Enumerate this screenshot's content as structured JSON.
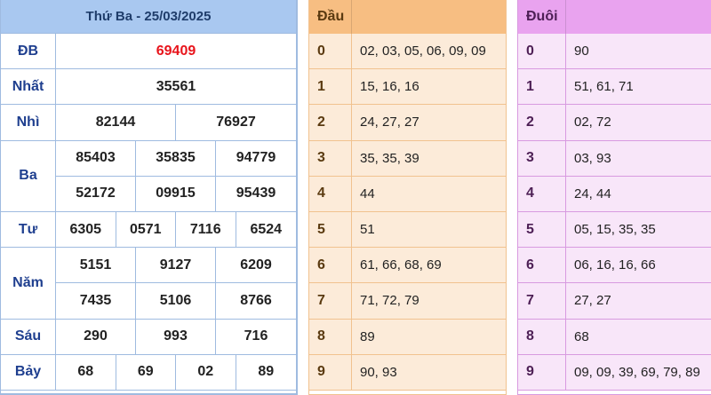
{
  "results": {
    "title": "Thứ Ba - 25/03/2025",
    "prizes": [
      {
        "label": "ĐB",
        "rows": [
          [
            "69409"
          ]
        ]
      },
      {
        "label": "Nhất",
        "rows": [
          [
            "35561"
          ]
        ]
      },
      {
        "label": "Nhì",
        "rows": [
          [
            "82144",
            "76927"
          ]
        ]
      },
      {
        "label": "Ba",
        "rows": [
          [
            "85403",
            "35835",
            "94779"
          ],
          [
            "52172",
            "09915",
            "95439"
          ]
        ]
      },
      {
        "label": "Tư",
        "rows": [
          [
            "6305",
            "0571",
            "7116",
            "6524"
          ]
        ]
      },
      {
        "label": "Năm",
        "rows": [
          [
            "5151",
            "9127",
            "6209"
          ],
          [
            "7435",
            "5106",
            "8766"
          ]
        ]
      },
      {
        "label": "Sáu",
        "rows": [
          [
            "290",
            "993",
            "716"
          ]
        ]
      },
      {
        "label": "Bảy",
        "rows": [
          [
            "68",
            "69",
            "02",
            "89"
          ]
        ]
      }
    ]
  },
  "dau": {
    "header": "Đầu",
    "rows": [
      {
        "digit": "0",
        "values": "02, 03, 05, 06, 09, 09"
      },
      {
        "digit": "1",
        "values": "15, 16, 16"
      },
      {
        "digit": "2",
        "values": "24, 27, 27"
      },
      {
        "digit": "3",
        "values": "35, 35, 39"
      },
      {
        "digit": "4",
        "values": "44"
      },
      {
        "digit": "5",
        "values": "51"
      },
      {
        "digit": "6",
        "values": "61, 66, 68, 69"
      },
      {
        "digit": "7",
        "values": "71, 72, 79"
      },
      {
        "digit": "8",
        "values": "89"
      },
      {
        "digit": "9",
        "values": "90, 93"
      }
    ]
  },
  "duoi": {
    "header": "Đuôi",
    "rows": [
      {
        "digit": "0",
        "values": "90"
      },
      {
        "digit": "1",
        "values": "51, 61, 71"
      },
      {
        "digit": "2",
        "values": "02, 72"
      },
      {
        "digit": "3",
        "values": "03, 93"
      },
      {
        "digit": "4",
        "values": "24, 44"
      },
      {
        "digit": "5",
        "values": "05, 15, 35, 35"
      },
      {
        "digit": "6",
        "values": "06, 16, 16, 66"
      },
      {
        "digit": "7",
        "values": "27, 27"
      },
      {
        "digit": "8",
        "values": "68"
      },
      {
        "digit": "9",
        "values": "09, 09, 39, 69, 79, 89"
      }
    ]
  },
  "colors": {
    "special_prize": "#e8141b",
    "results_header": "#a9c8f0",
    "dau_header": "#f7be82",
    "dau_body": "#fcebd9",
    "duoi_header": "#e9a3ef",
    "duoi_body": "#f8e6f9"
  }
}
